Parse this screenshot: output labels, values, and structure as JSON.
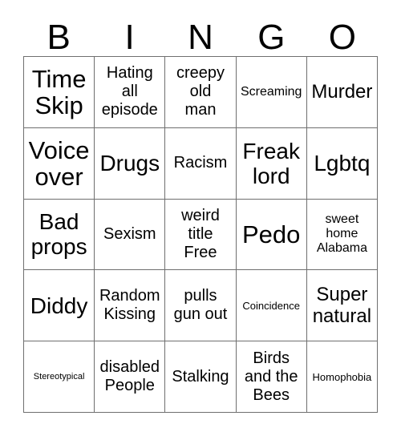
{
  "card": {
    "title": "BINGO",
    "header_letters": [
      "B",
      "I",
      "N",
      "G",
      "O"
    ],
    "colors": {
      "background": "#ffffff",
      "text": "#000000",
      "grid_line": "#6f6f6f"
    },
    "grid": {
      "columns": 5,
      "rows": 5,
      "free_space": "weird title Free"
    },
    "cells": [
      {
        "text": "Time\nSkip",
        "size": "fs-xl"
      },
      {
        "text": "Hating\nall\nepisode",
        "size": "fs-sm"
      },
      {
        "text": "creepy\nold\nman",
        "size": "fs-sm"
      },
      {
        "text": "Screaming",
        "size": "fs-xs"
      },
      {
        "text": "Murder",
        "size": "fs-md"
      },
      {
        "text": "Voice\nover",
        "size": "fs-xl"
      },
      {
        "text": "Drugs",
        "size": "fs-lg"
      },
      {
        "text": "Racism",
        "size": "fs-sm"
      },
      {
        "text": "Freak\nlord",
        "size": "fs-lg"
      },
      {
        "text": "Lgbtq",
        "size": "fs-lg"
      },
      {
        "text": "Bad\nprops",
        "size": "fs-lg"
      },
      {
        "text": "Sexism",
        "size": "fs-sm"
      },
      {
        "text": "weird\ntitle\nFree",
        "size": "fs-sm"
      },
      {
        "text": "Pedo",
        "size": "fs-xl"
      },
      {
        "text": "sweet\nhome\nAlabama",
        "size": "fs-xs"
      },
      {
        "text": "Diddy",
        "size": "fs-lg"
      },
      {
        "text": "Random\nKissing",
        "size": "fs-sm"
      },
      {
        "text": "pulls\ngun out",
        "size": "fs-sm"
      },
      {
        "text": "Coincidence",
        "size": "fs-xxs"
      },
      {
        "text": "Super\nnatural",
        "size": "fs-md"
      },
      {
        "text": "Stereotypical",
        "size": "fs-tiny"
      },
      {
        "text": "disabled\nPeople",
        "size": "fs-sm"
      },
      {
        "text": "Stalking",
        "size": "fs-sm"
      },
      {
        "text": "Birds\nand the\nBees",
        "size": "fs-sm"
      },
      {
        "text": "Homophobia",
        "size": "fs-xxs"
      }
    ]
  }
}
